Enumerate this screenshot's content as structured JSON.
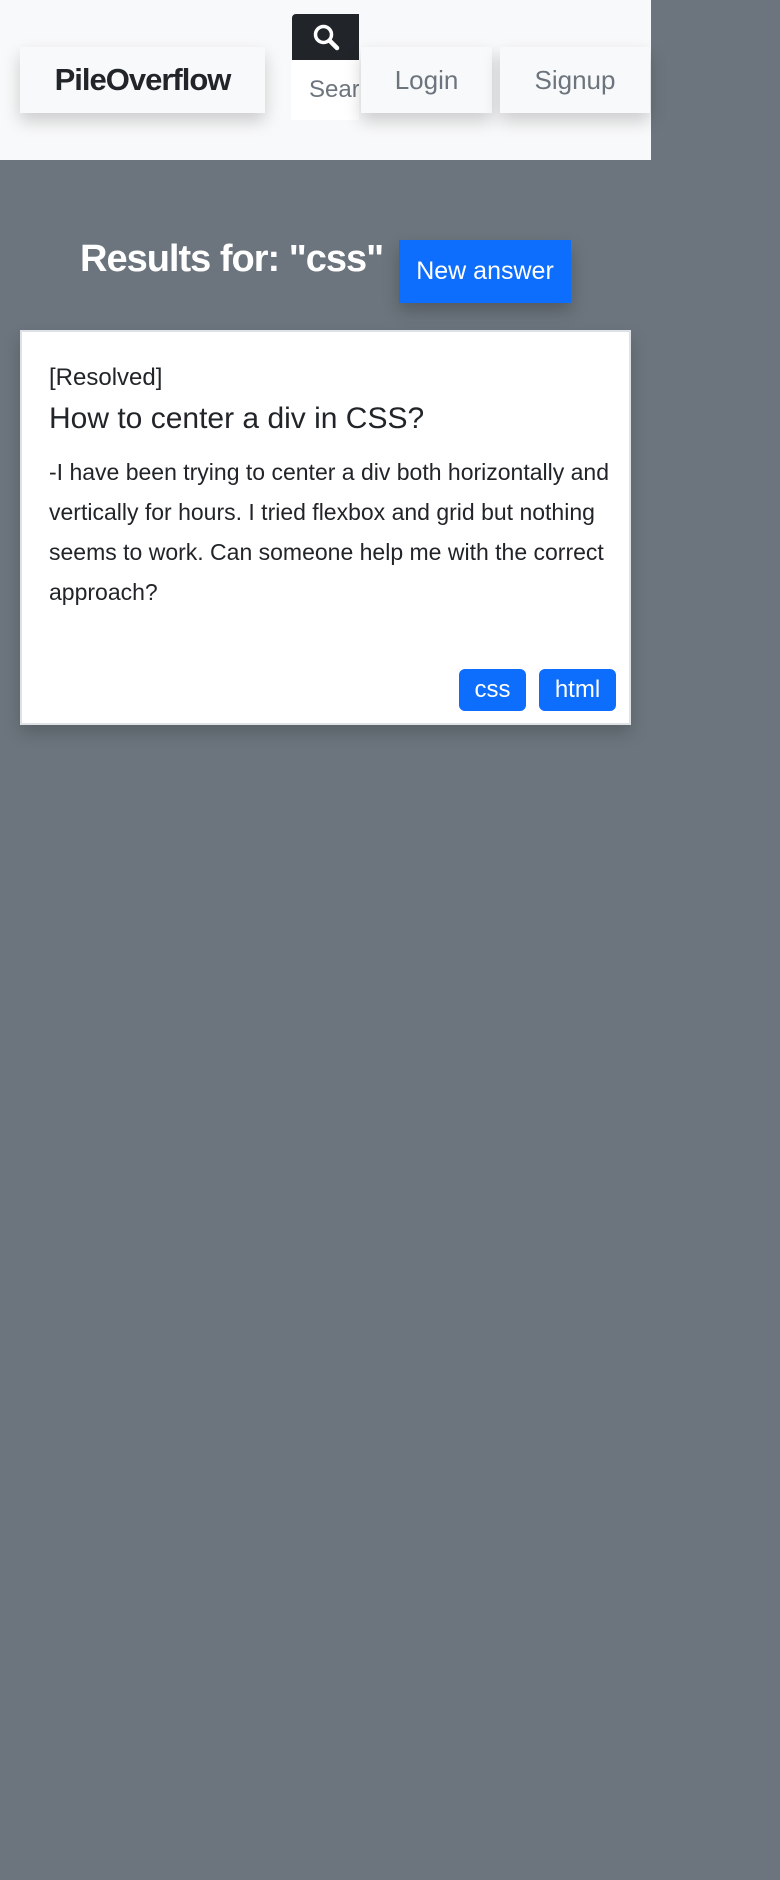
{
  "navbar": {
    "brand": "PileOverflow",
    "search_placeholder": "Search",
    "login": "Login",
    "signup": "Signup"
  },
  "results": {
    "title": "Results for: \"css\"",
    "new_answer": "New answer"
  },
  "question": {
    "status": "[Resolved]",
    "title": "How to center a div in CSS?",
    "body": "-I have been trying to center a div both horizontally and vertically for hours. I tried flexbox and grid but nothing seems to work. Can someone help me with the correct approach?",
    "tags": [
      "css",
      "html"
    ]
  },
  "colors": {
    "page_background": "#6c757d",
    "navbar_background": "#f8f9fa",
    "accent": "#0d6efd",
    "search_button": "#212529"
  },
  "icons": {
    "search": "search-icon"
  }
}
